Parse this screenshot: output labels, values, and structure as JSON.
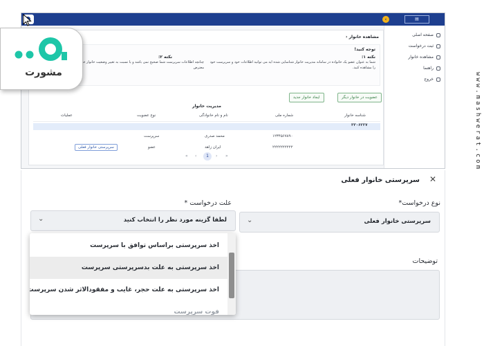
{
  "top": {
    "breadcrumb": "مشاهده خانوار",
    "sidebar": [
      "صفحه اصلی",
      "ثبت درخواست",
      "مشاهده خانوار",
      "راهنما",
      "خروج"
    ],
    "notice": {
      "heading": "توجه کنید!",
      "note1_title": "نکته ۱:",
      "note1_text": "شما به عنوان عضو یک خانواده در سامانه مدیریت خانوار شناسایی شده اید می توانید اطلاعات خود و سرپرست خود",
      "note1_text2": "را مشاهده کنید.",
      "note2_title": "نکته ۲:",
      "note2_text": "چنانچه اطلاعات سرپرست شما صحیح نمی باشد و یا نسبت به تغییر وضعیت خانوار خود",
      "note2_text2": "معترض"
    },
    "buttons": {
      "other_family": "عضویت در خانوار دیگر",
      "new_family": "ایجاد خانوار جدید"
    },
    "table": {
      "title": "مدیریت خانوار",
      "headers": [
        "شناسه خانوار",
        "شماره ملی",
        "نام و نام خانوادگی",
        "نوع عضویت",
        "عملیات"
      ],
      "family_id": "۳۳۰۶۲۲۷",
      "rows": [
        {
          "national_id": "۱۲۳۴۵۶۷۸۹۰",
          "name": "محمد صدری",
          "membership": "سرپرست",
          "action": ""
        },
        {
          "national_id": "۲۲۲۲۲۲۲۲۲۲",
          "name": "ایران زاهد",
          "membership": "عضو",
          "action": "سرپرستی خانوار فعلی"
        }
      ]
    },
    "pager": {
      "current": "1"
    }
  },
  "logo": {
    "text": "مشورت"
  },
  "watermark": "www.mashwerat.com",
  "form": {
    "title": "سرپرستی خانوار فعلی",
    "request_type_label": "نوع درخواست*",
    "request_type_value": "سرپرستی خانوار فعلی",
    "reason_label": "علت درخواست *",
    "reason_placeholder": "لطفا گزینه مورد نظر را انتخاب کنید",
    "description_label": "توضیحات",
    "options": [
      "اخذ سرپرستی براساس توافق با سرپرست",
      "اخذ سرپرستی به علت بدسرپرستی سرپرست",
      "اخذ سرپرستی به علت حجر، غایب و مفقودالاثر شدن سرپرست",
      "فوت سرپرست"
    ]
  }
}
